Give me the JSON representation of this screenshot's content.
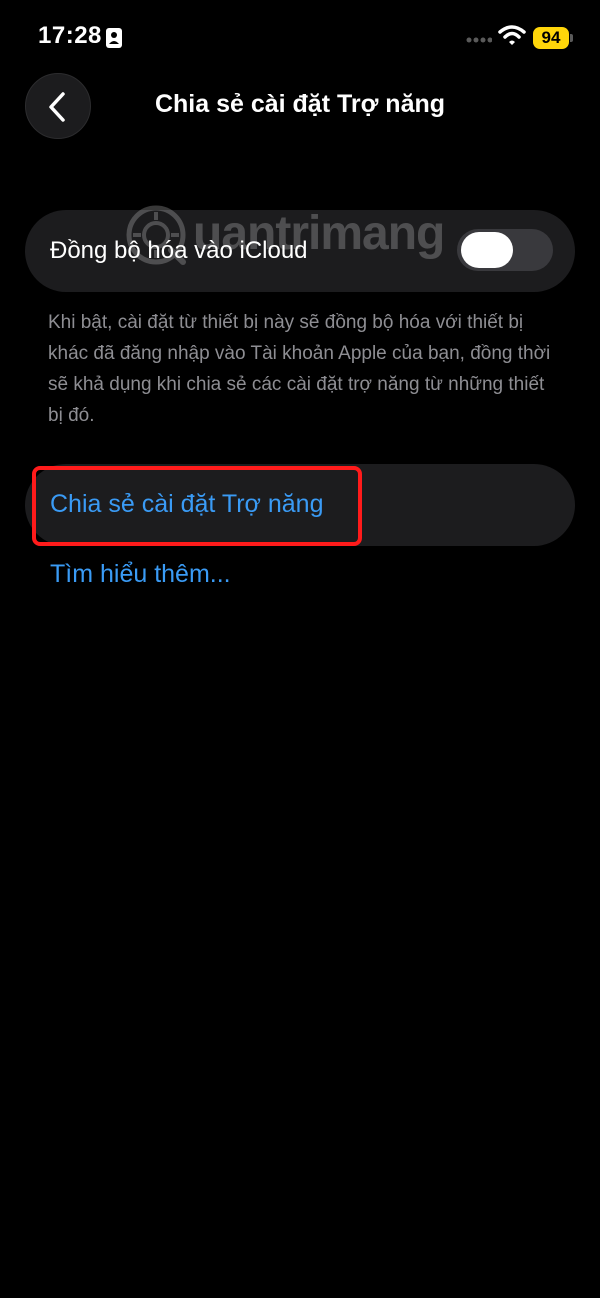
{
  "status_bar": {
    "time": "17:28",
    "battery": "94",
    "battery_color": "#ffd60a",
    "icons": [
      "focus-person-icon",
      "signal-dots-icon",
      "wifi-icon",
      "battery-icon"
    ]
  },
  "header": {
    "title": "Chia sẻ cài đặt Trợ năng",
    "back_icon": "chevron-left-icon"
  },
  "icloud_sync": {
    "label": "Đồng bộ hóa vào iCloud",
    "toggle_on": false
  },
  "description": "Khi bật, cài đặt từ thiết bị này sẽ đồng bộ hóa với thiết bị khác đã đăng nhập vào Tài khoản Apple của bạn, đồng thời sẽ khả dụng khi chia sẻ các cài đặt trợ năng từ những thiết bị đó.",
  "share": {
    "label": "Chia sẻ cài đặt Trợ năng"
  },
  "learn_more": "Tìm hiểu thêm...",
  "watermark": {
    "text": "uantrimang"
  },
  "colors": {
    "background": "#000000",
    "card": "#1c1c1e",
    "link": "#3a9bf5",
    "secondary_text": "#8e8e93",
    "highlight": "#ff1b1b"
  }
}
